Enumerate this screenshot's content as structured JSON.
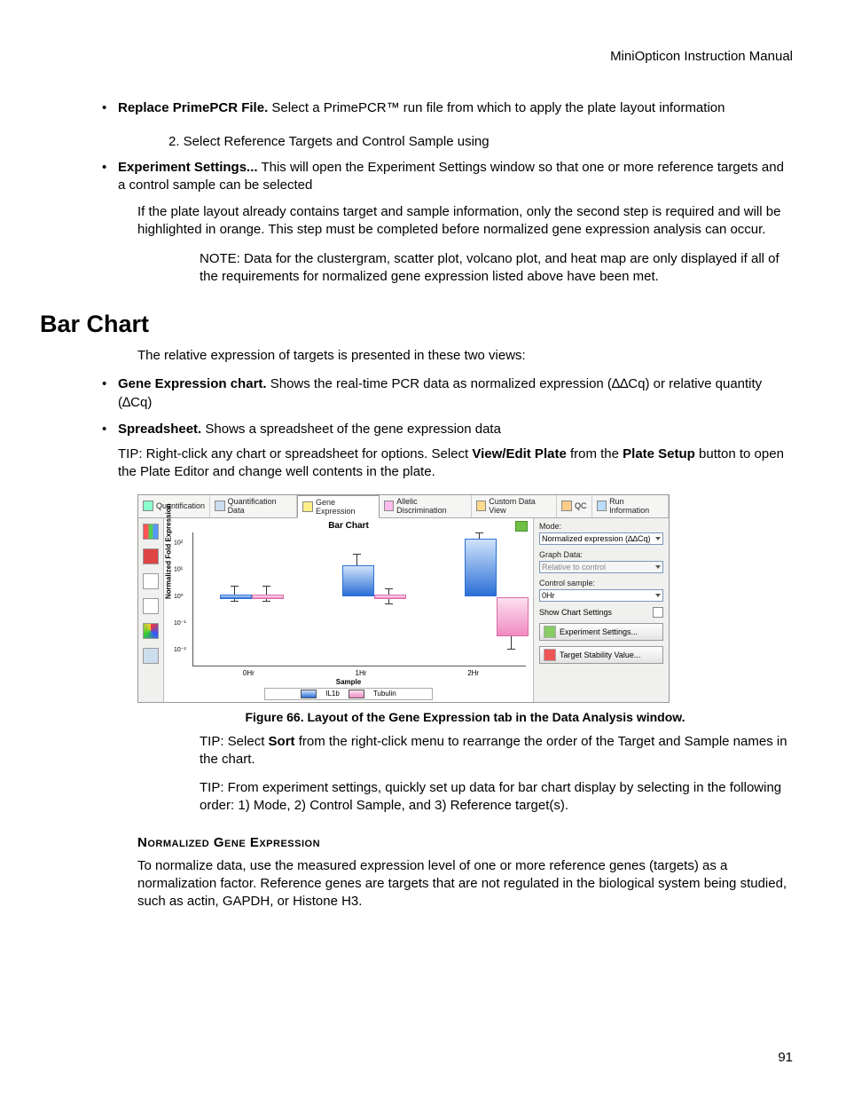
{
  "header": "MiniOpticon Instruction Manual",
  "replace_bold": "Replace PrimePCR File.",
  "replace_text": " Select a PrimePCR™ run file from which to apply the plate layout information",
  "step2": "2. Select Reference Targets and Control Sample using",
  "exp_bold": "Experiment Settings...",
  "exp_text": " This will open the Experiment Settings window so that one or more reference targets and a control sample can be selected",
  "para_plate": "If the plate layout already contains target and sample information, only the second step is required and will be highlighted in orange. This step must be completed before normalized gene expression analysis can occur.",
  "note": "NOTE: Data for the clustergram, scatter plot, volcano plot, and heat map are only displayed if all of the requirements for normalized gene expression listed above have been met.",
  "h2": "Bar Chart",
  "barchart_intro": "The relative expression of targets is presented in these two views:",
  "gec_bold": "Gene Expression chart.",
  "gec_text": " Shows the real-time PCR data as normalized expression (∆∆Cq) or relative quantity (∆Cq)",
  "ss_bold": "Spreadsheet.",
  "ss_text": " Shows a spreadsheet of the gene expression data",
  "tip1a": "TIP: Right-click any chart or spreadsheet for options. Select ",
  "tip1b": "View/Edit Plate",
  "tip1c": " from the ",
  "tip1d": "Plate Setup",
  "tip1e": " button to open the Plate Editor and change well contents in the plate.",
  "tabs": [
    "Quantification",
    "Quantification Data",
    "Gene Expression",
    "Allelic Discrimination",
    "Custom Data View",
    "QC",
    "Run Information"
  ],
  "chart_title": "Bar Chart",
  "chart_data": {
    "type": "bar",
    "ylabel": "Normalized Fold Expression",
    "xlabel": "Sample",
    "categories": [
      "0Hr",
      "1Hr",
      "2Hr"
    ],
    "yticks": [
      "10²",
      "10¹",
      "10⁰",
      "10⁻¹",
      "10⁻²"
    ],
    "ylim_log10": [
      -2.5,
      2.5
    ],
    "series": [
      {
        "name": "IL1b",
        "color": "blue",
        "values_log10": [
          0,
          1,
          2.2
        ]
      },
      {
        "name": "Tubulin",
        "color": "pink",
        "values_log10": [
          0,
          0,
          -1.5
        ]
      }
    ],
    "legend": [
      "IL1b",
      "Tubulin"
    ]
  },
  "side": {
    "mode_label": "Mode:",
    "mode_value": "Normalized expression (∆∆Cq)",
    "graph_label": "Graph Data:",
    "graph_value": "Relative to control",
    "ctrl_label": "Control sample:",
    "ctrl_value": "0Hr",
    "show_chart": "Show Chart Settings",
    "btn_exp": "Experiment Settings...",
    "btn_tsv": "Target Stability Value..."
  },
  "fig_caption": "Figure 66. Layout of the Gene Expression tab in the Data Analysis window.",
  "tip2a": "TIP: Select ",
  "tip2b": "Sort",
  "tip2c": " from the right-click menu to rearrange the order of the Target and Sample names in the chart.",
  "tip3": "TIP: From experiment settings, quickly set up data for bar chart display by selecting in the following order: 1) Mode, 2) Control Sample, and 3) Reference target(s).",
  "subhead": "Normalized Gene Expression",
  "norm_para": "To normalize data, use the measured expression level of one or more reference genes (targets) as a normalization factor. Reference genes are targets that are not regulated in the biological system being studied, such as actin, GAPDH, or Histone H3.",
  "page_num": "91"
}
